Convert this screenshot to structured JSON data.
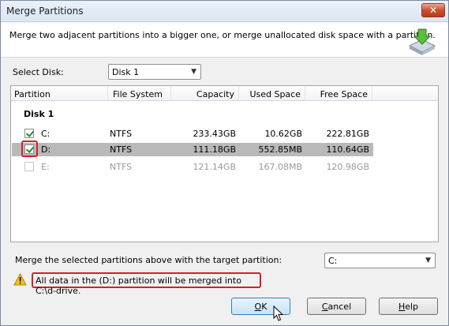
{
  "window": {
    "title": "Merge Partitions",
    "close_glyph": "✕",
    "description": "Merge two adjacent partitions into a bigger one, or merge unallocated disk space with a partition.",
    "header_icon": "merge-partition-icon"
  },
  "disk_select": {
    "label": "Select Disk:",
    "value": "Disk 1"
  },
  "table": {
    "columns": [
      "Partition",
      "File System",
      "Capacity",
      "Used Space",
      "Free Space"
    ],
    "group_label": "Disk 1",
    "rows": [
      {
        "checked": true,
        "partition": "C:",
        "file_system": "NTFS",
        "capacity": "233.43GB",
        "used": "10.62GB",
        "free": "222.81GB",
        "state": "normal"
      },
      {
        "checked": true,
        "partition": "D:",
        "file_system": "NTFS",
        "capacity": "111.18GB",
        "used": "552.85MB",
        "free": "110.64GB",
        "state": "selected"
      },
      {
        "checked": false,
        "partition": "E:",
        "file_system": "NTFS",
        "capacity": "121.14GB",
        "used": "167.08MB",
        "free": "120.98GB",
        "state": "disabled"
      }
    ]
  },
  "target": {
    "label": "Merge the selected partitions above with the target partition:",
    "value": "C:"
  },
  "warning": {
    "icon": "warning-icon",
    "text": "All data in the (D:) partition will be merged into C:\\d-drive."
  },
  "buttons": {
    "ok_accel": "O",
    "ok_rest": "K",
    "cancel_accel": "C",
    "cancel_rest": "ancel",
    "help_accel": "H",
    "help_rest": "elp"
  },
  "colors": {
    "highlight_red": "#d2202f",
    "selected_row": "#b9b9b9",
    "check_green": "#2a8c2a"
  }
}
